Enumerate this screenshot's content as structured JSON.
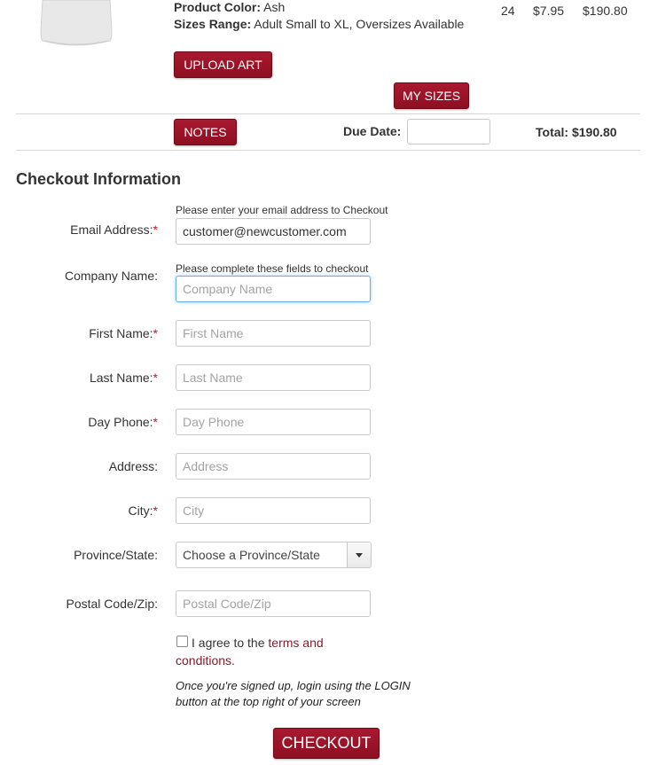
{
  "product": {
    "color_label": "Product Color:",
    "color_value": "Ash",
    "sizes_label": "Sizes Range:",
    "sizes_value": "Adult Small to XL, Oversizes Available",
    "qty": "24",
    "unit_price": "$7.95",
    "subtotal": "$190.80"
  },
  "buttons": {
    "upload_art": "UPLOAD ART",
    "my_sizes": "MY SIZES",
    "notes": "NOTES",
    "checkout": "CHECKOUT"
  },
  "order": {
    "due_date_label": "Due Date:",
    "total": "Total: $190.80"
  },
  "checkout": {
    "title": "Checkout Information",
    "email_hint": "Please enter your email address to Checkout",
    "company_hint": "Please complete these fields to checkout",
    "required_mark": "*",
    "fields": {
      "email": {
        "label": "Email Address:",
        "value": "customer@newcustomer.com"
      },
      "company": {
        "label": "Company Name:",
        "placeholder": "Company Name"
      },
      "first_name": {
        "label": "First Name:",
        "placeholder": "First Name"
      },
      "last_name": {
        "label": "Last Name:",
        "placeholder": "Last Name"
      },
      "day_phone": {
        "label": "Day Phone:",
        "placeholder": "Day Phone"
      },
      "address": {
        "label": "Address:",
        "placeholder": "Address"
      },
      "city": {
        "label": "City:",
        "placeholder": "City"
      },
      "province": {
        "label": "Province/State:",
        "selected": "Choose a Province/State"
      },
      "postal": {
        "label": "Postal Code/Zip:",
        "placeholder": "Postal Code/Zip"
      }
    },
    "agree_prefix": "I agree to the",
    "terms_link_1": "terms and",
    "terms_link_2": "conditions",
    "agree_suffix": ".",
    "note_line1": "Once you're signed up, login using the LOGIN",
    "note_line2": "button at the top right of your screen"
  },
  "theme": {
    "button_color": "#9b1427",
    "required_color": "#c8102e",
    "link_color": "#8b1a2b",
    "focus_color": "#66afe9"
  },
  "icons": {
    "product_thumbnail": "shirt-image",
    "select_arrow": "chevron-down-icon"
  }
}
